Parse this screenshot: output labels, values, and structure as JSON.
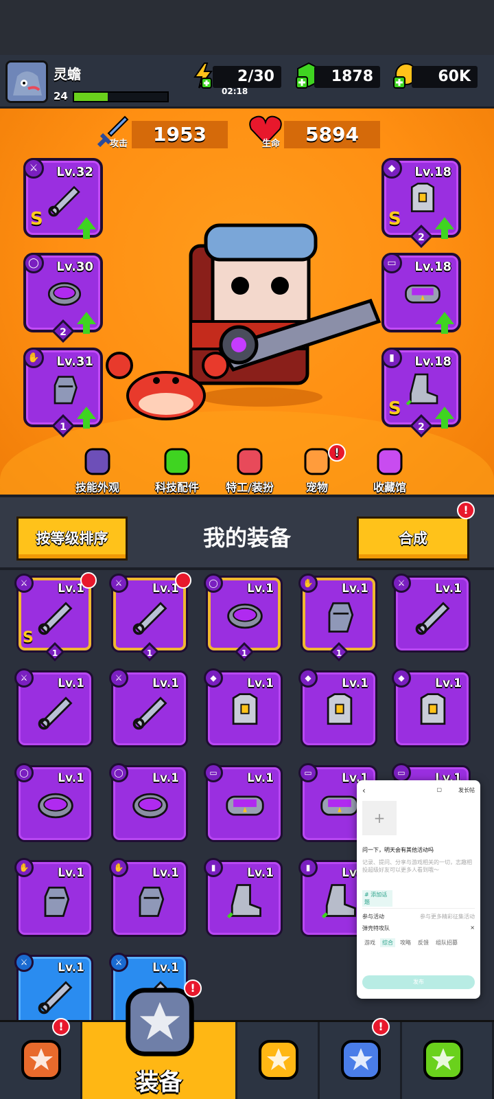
{
  "player": {
    "name": "灵蟾",
    "level": "24",
    "xp_fraction": 0.36
  },
  "resources": {
    "energy": "2/30",
    "energy_timer": "02:18",
    "gems": "1878",
    "coins": "60K"
  },
  "stats": {
    "attack_label": "攻击",
    "attack_value": "1953",
    "hp_label": "生命",
    "hp_value": "5894"
  },
  "equipped": [
    {
      "slot": "weapon",
      "level": "Lv.32",
      "rarity": "S",
      "stars": "",
      "upgrade": true
    },
    {
      "slot": "necklace",
      "level": "Lv.30",
      "rarity": "",
      "stars": "2",
      "upgrade": true
    },
    {
      "slot": "glove",
      "level": "Lv.31",
      "rarity": "",
      "stars": "1",
      "upgrade": true
    },
    {
      "slot": "armor",
      "level": "Lv.18",
      "rarity": "S",
      "stars": "2",
      "upgrade": true
    },
    {
      "slot": "belt",
      "level": "Lv.18",
      "rarity": "",
      "stars": "",
      "upgrade": true
    },
    {
      "slot": "boots",
      "level": "Lv.18",
      "rarity": "S",
      "stars": "2",
      "upgrade": true
    }
  ],
  "tabs": [
    {
      "label": "技能外观",
      "badge": false
    },
    {
      "label": "科技配件",
      "badge": false
    },
    {
      "label": "特工/装扮",
      "badge": false
    },
    {
      "label": "宠物",
      "badge": true
    },
    {
      "label": "收藏馆",
      "badge": false
    }
  ],
  "inventory_header": {
    "sort_label": "按等级排序",
    "title": "我的装备",
    "merge_label": "合成"
  },
  "inventory": [
    {
      "type": "weapon",
      "level": "Lv.1",
      "rarity": "S",
      "stars": "1",
      "frame": "gold",
      "new": true
    },
    {
      "type": "weapon",
      "level": "Lv.1",
      "rarity": "",
      "stars": "1",
      "frame": "gold",
      "new": true
    },
    {
      "type": "necklace",
      "level": "Lv.1",
      "rarity": "",
      "stars": "1",
      "frame": "gold",
      "new": false
    },
    {
      "type": "glove",
      "level": "Lv.1",
      "rarity": "",
      "stars": "1",
      "frame": "gold",
      "new": false
    },
    {
      "type": "weapon",
      "level": "Lv.1",
      "rarity": "",
      "stars": "",
      "frame": "purple",
      "new": false
    },
    {
      "type": "weapon",
      "level": "Lv.1",
      "rarity": "",
      "stars": "",
      "frame": "purple",
      "new": false
    },
    {
      "type": "weapon",
      "level": "Lv.1",
      "rarity": "",
      "stars": "",
      "frame": "purple",
      "new": false
    },
    {
      "type": "armor",
      "level": "Lv.1",
      "rarity": "",
      "stars": "",
      "frame": "purple",
      "new": false
    },
    {
      "type": "armor",
      "level": "Lv.1",
      "rarity": "",
      "stars": "",
      "frame": "purple",
      "new": false
    },
    {
      "type": "armor",
      "level": "Lv.1",
      "rarity": "",
      "stars": "",
      "frame": "purple",
      "new": false
    },
    {
      "type": "necklace",
      "level": "Lv.1",
      "rarity": "",
      "stars": "",
      "frame": "purple",
      "new": false
    },
    {
      "type": "necklace",
      "level": "Lv.1",
      "rarity": "",
      "stars": "",
      "frame": "purple",
      "new": false
    },
    {
      "type": "belt",
      "level": "Lv.1",
      "rarity": "",
      "stars": "",
      "frame": "purple",
      "new": false
    },
    {
      "type": "belt",
      "level": "Lv.1",
      "rarity": "",
      "stars": "",
      "frame": "purple",
      "new": false
    },
    {
      "type": "belt",
      "level": "Lv.1",
      "rarity": "",
      "stars": "",
      "frame": "purple",
      "new": false
    },
    {
      "type": "glove",
      "level": "Lv.1",
      "rarity": "",
      "stars": "",
      "frame": "purple",
      "new": false
    },
    {
      "type": "glove",
      "level": "Lv.1",
      "rarity": "",
      "stars": "",
      "frame": "purple",
      "new": false
    },
    {
      "type": "boots",
      "level": "Lv.1",
      "rarity": "",
      "stars": "",
      "frame": "purple",
      "new": false
    },
    {
      "type": "boots",
      "level": "Lv.1",
      "rarity": "",
      "stars": "",
      "frame": "purple",
      "new": false
    },
    {
      "type": "boots",
      "level": "Lv.1",
      "rarity": "",
      "stars": "",
      "frame": "purple",
      "new": false
    },
    {
      "type": "weapon",
      "level": "Lv.1",
      "rarity": "",
      "stars": "",
      "frame": "blue",
      "new": false
    },
    {
      "type": "weapon",
      "level": "Lv.1",
      "rarity": "",
      "stars": "",
      "frame": "blue",
      "new": false
    }
  ],
  "bottom_nav": [
    {
      "name": "shop",
      "label": "",
      "badge": true
    },
    {
      "name": "equipment",
      "label": "装备",
      "badge": true
    },
    {
      "name": "battle",
      "label": "",
      "badge": false
    },
    {
      "name": "world",
      "label": "",
      "badge": true
    },
    {
      "name": "evolution",
      "label": "",
      "badge": false
    }
  ],
  "overlay": {
    "post_label": "发长帖",
    "question": "问一下，明天会有其他活动吗",
    "hint": "记录、提问、分享与游戏相关的一切，志趣相投超级好友可以更多人看到哦～",
    "topic": "# 添加话题",
    "activity_label": "参与活动",
    "activity_hint": "参与更多精彩征集活动",
    "group": "弹壳特攻队",
    "tags": [
      "游戏",
      "综合",
      "攻略",
      "反馈",
      "组队招募"
    ],
    "publish": "发布"
  },
  "colors": {
    "accent": "#ffb714",
    "purple": "#9a2fe0",
    "orange": "#ff8f12",
    "badge": "#e8182c"
  }
}
